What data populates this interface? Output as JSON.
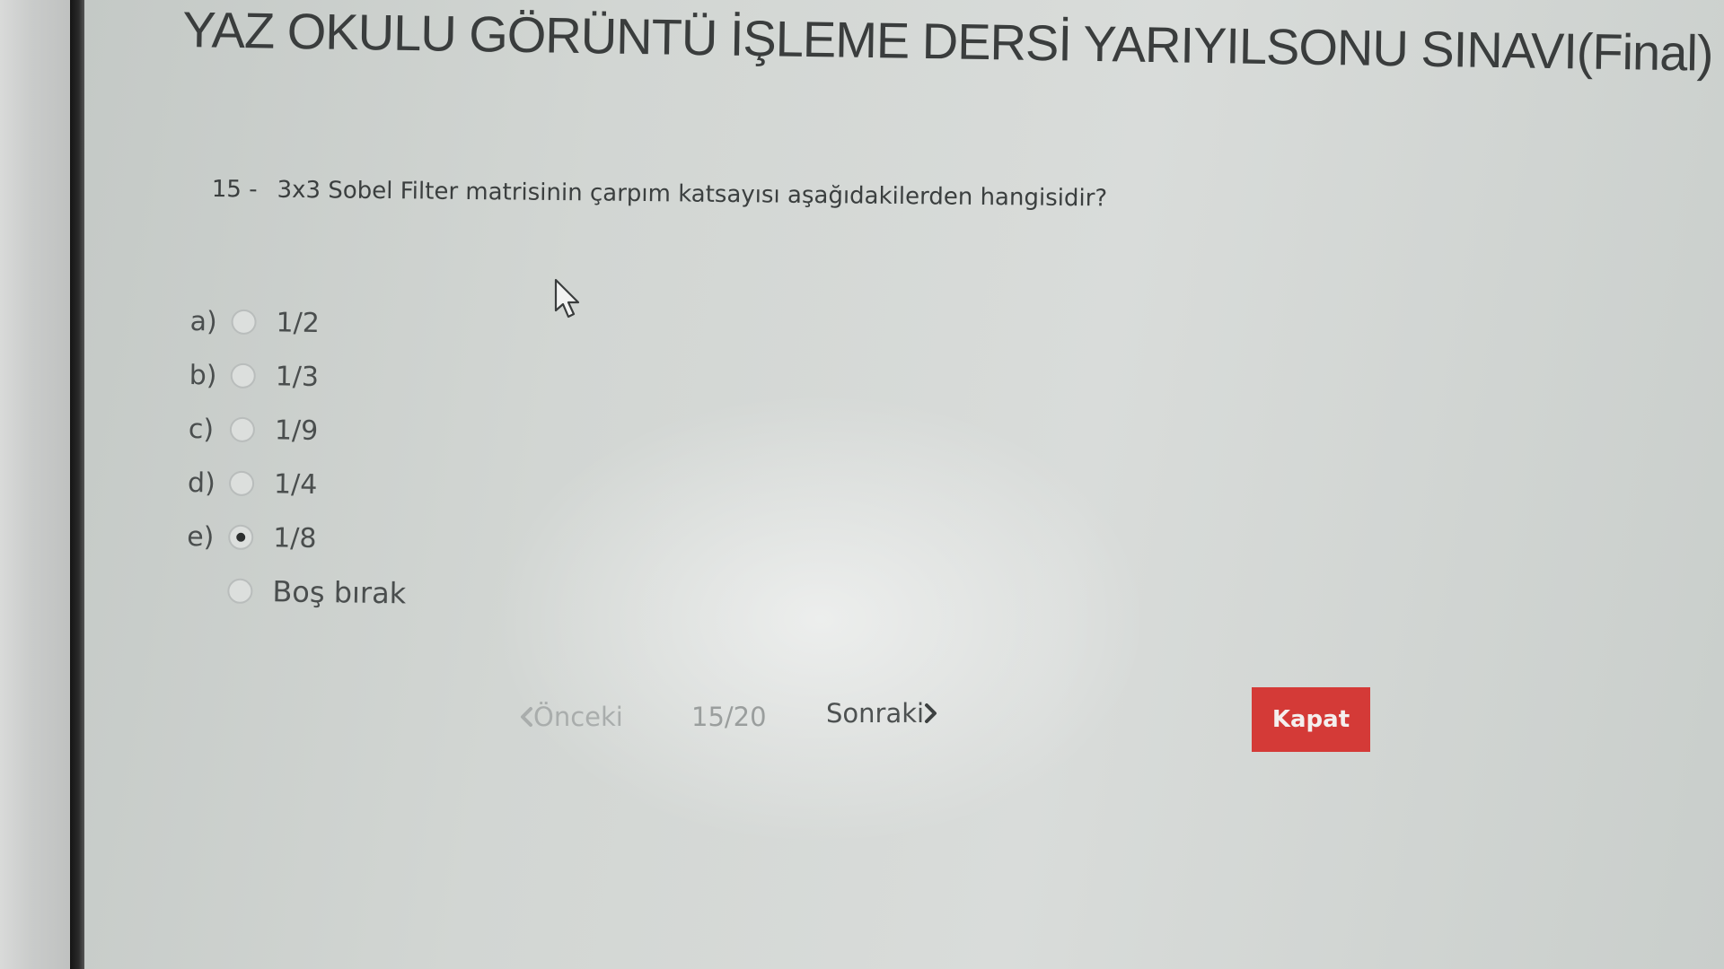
{
  "exam": {
    "title": "YAZ OKULU GÖRÜNTÜ İŞLEME DERSİ YARIYILSONU SINAVI(Final)"
  },
  "question": {
    "number": "15 -",
    "text": "3x3 Sobel Filter matrisinin çarpım katsayısı aşağıdakilerden hangisidir?"
  },
  "options": [
    {
      "letter": "a)",
      "value": "1/2",
      "selected": false
    },
    {
      "letter": "b)",
      "value": "1/3",
      "selected": false
    },
    {
      "letter": "c)",
      "value": "1/9",
      "selected": false
    },
    {
      "letter": "d)",
      "value": "1/4",
      "selected": false
    },
    {
      "letter": "e)",
      "value": "1/8",
      "selected": true
    }
  ],
  "skip_option": {
    "label": "Boş bırak",
    "selected": false
  },
  "navigation": {
    "prev_label": "Önceki",
    "page_indicator": "15/20",
    "next_label": "Sonraki",
    "close_label": "Kapat"
  },
  "colors": {
    "close_button": "#d43a37",
    "title_text": "#3a3d3d"
  },
  "icons": {
    "cursor": "mouse-pointer-icon",
    "prev": "chevron-left-icon",
    "next": "chevron-right-icon"
  }
}
